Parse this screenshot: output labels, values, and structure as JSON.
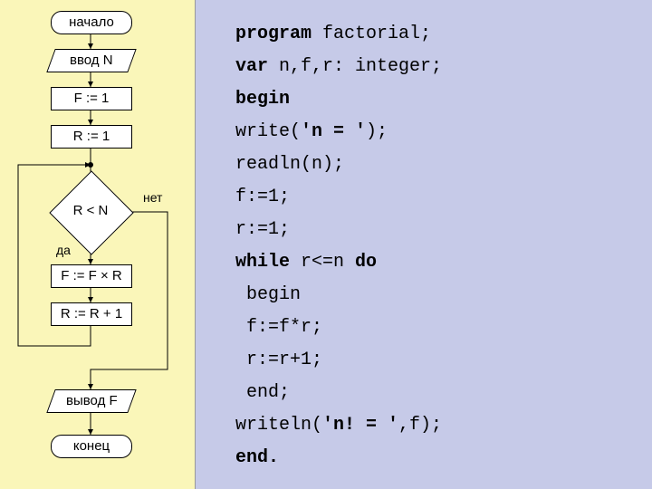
{
  "flowchart": {
    "start": "начало",
    "input": "ввод N",
    "assignF": "F := 1",
    "assignR": "R := 1",
    "cond": "R < N",
    "yes": "да",
    "no": "нет",
    "body1": "F := F × R",
    "body2": "R := R + 1",
    "output": "вывод F",
    "end": "конец"
  },
  "code": {
    "l1_kw": "program",
    "l1_rest": " factorial;",
    "l2_kw": "var",
    "l2_rest": " n,f,r: integer;",
    "l3_kw": "begin",
    "l4_a": "write(",
    "l4_str": "'n = '",
    "l4_b": ");",
    "l5": "readln(n);",
    "l6": "f:=1;",
    "l7": "r:=1;",
    "l8_kw1": "while",
    "l8_mid": " r<=n ",
    "l8_kw2": "do",
    "l9": " begin",
    "l10": " f:=f*r;",
    "l11": " r:=r+1;",
    "l12": " end;",
    "l13_a": "writeln(",
    "l13_str": "'n! = '",
    "l13_b": ",f);",
    "l14_kw": "end."
  }
}
